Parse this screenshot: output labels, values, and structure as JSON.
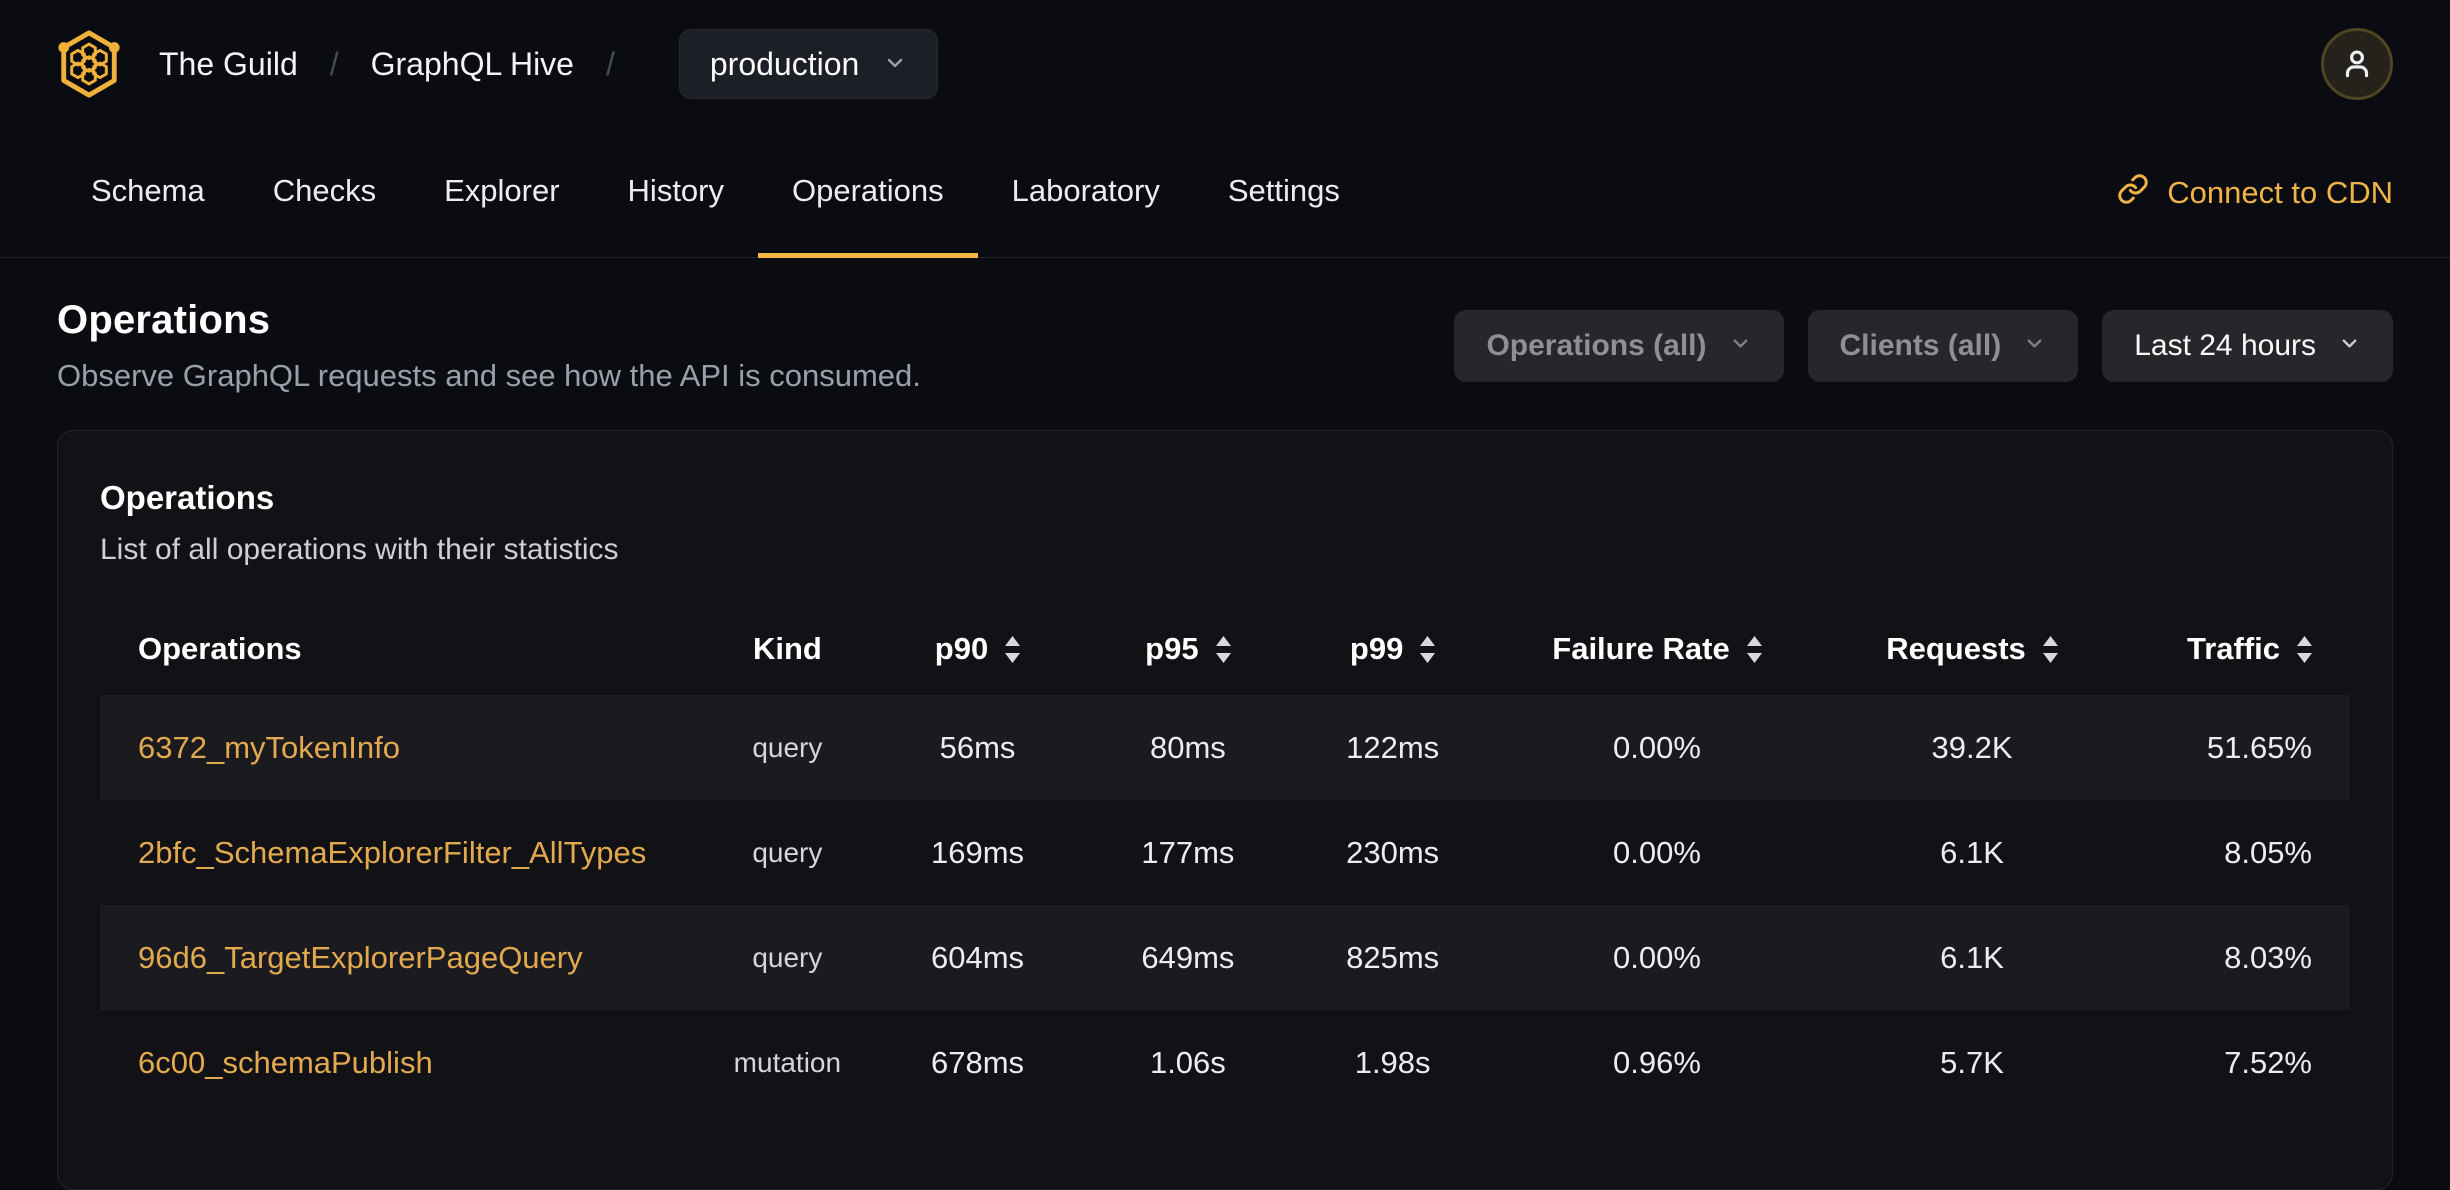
{
  "theme": {
    "accent_gold": "#f4b740",
    "operation_link_color": "#e2a94e",
    "page_background": "#0a0c11",
    "card_background": "#121216"
  },
  "header": {
    "org": "The Guild",
    "project": "GraphQL Hive",
    "separator": "/",
    "target_selector": {
      "value": "production"
    }
  },
  "nav": {
    "tabs": [
      {
        "label": "Schema"
      },
      {
        "label": "Checks"
      },
      {
        "label": "Explorer"
      },
      {
        "label": "History"
      },
      {
        "label": "Operations"
      },
      {
        "label": "Laboratory"
      },
      {
        "label": "Settings"
      }
    ],
    "active_tab": "Operations",
    "cdn_link_label": "Connect to CDN"
  },
  "page": {
    "title": "Operations",
    "subtitle": "Observe GraphQL requests and see how the API is consumed."
  },
  "filters": {
    "operations": "Operations (all)",
    "clients": "Clients (all)",
    "period": "Last 24 hours"
  },
  "card": {
    "title": "Operations",
    "subtitle": "List of all operations with their statistics"
  },
  "table": {
    "columns": [
      {
        "label": "Operations",
        "sortable": false
      },
      {
        "label": "Kind",
        "sortable": false
      },
      {
        "label": "p90",
        "sortable": true
      },
      {
        "label": "p95",
        "sortable": true
      },
      {
        "label": "p99",
        "sortable": true
      },
      {
        "label": "Failure Rate",
        "sortable": true
      },
      {
        "label": "Requests",
        "sortable": true
      },
      {
        "label": "Traffic",
        "sortable": true
      }
    ],
    "rows": [
      {
        "operation": "6372_myTokenInfo",
        "kind": "query",
        "p90": "56ms",
        "p95": "80ms",
        "p99": "122ms",
        "failure_rate": "0.00%",
        "requests": "39.2K",
        "traffic": "51.65%"
      },
      {
        "operation": "2bfc_SchemaExplorerFilter_AllTypes",
        "kind": "query",
        "p90": "169ms",
        "p95": "177ms",
        "p99": "230ms",
        "failure_rate": "0.00%",
        "requests": "6.1K",
        "traffic": "8.05%"
      },
      {
        "operation": "96d6_TargetExplorerPageQuery",
        "kind": "query",
        "p90": "604ms",
        "p95": "649ms",
        "p99": "825ms",
        "failure_rate": "0.00%",
        "requests": "6.1K",
        "traffic": "8.03%"
      },
      {
        "operation": "6c00_schemaPublish",
        "kind": "mutation",
        "p90": "678ms",
        "p95": "1.06s",
        "p99": "1.98s",
        "failure_rate": "0.96%",
        "requests": "5.7K",
        "traffic": "7.52%"
      }
    ]
  },
  "icons": {
    "logo": "hive-logo",
    "dropdown": "chevron-down-icon",
    "cdn": "link-icon",
    "avatar": "user-icon",
    "sort": "sort-arrows-icon"
  }
}
